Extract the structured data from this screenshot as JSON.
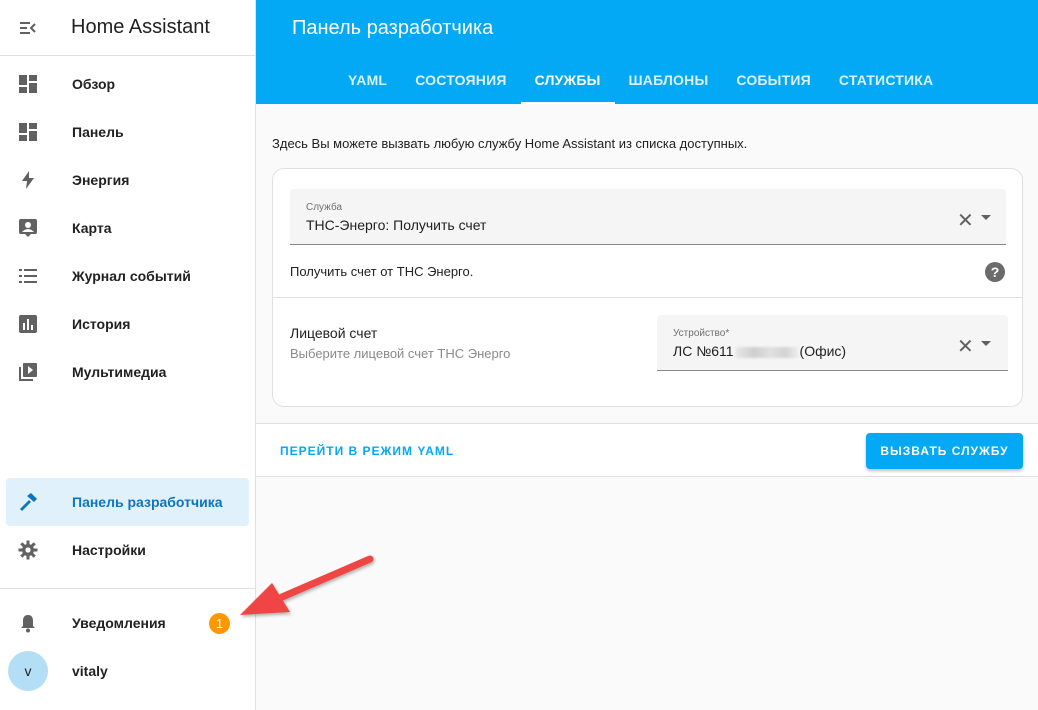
{
  "app": {
    "title": "Home Assistant"
  },
  "sidebar": {
    "items": [
      {
        "label": "Обзор",
        "icon": "overview-icon"
      },
      {
        "label": "Панель",
        "icon": "dashboard-icon"
      },
      {
        "label": "Энергия",
        "icon": "lightning-icon"
      },
      {
        "label": "Карта",
        "icon": "map-person-icon"
      },
      {
        "label": "Журнал событий",
        "icon": "list-icon"
      },
      {
        "label": "История",
        "icon": "chart-icon"
      },
      {
        "label": "Мультимедиа",
        "icon": "media-icon"
      }
    ],
    "bottom": [
      {
        "label": "Панель разработчика",
        "icon": "hammer-icon",
        "active": true
      },
      {
        "label": "Настройки",
        "icon": "gear-icon"
      }
    ],
    "notifications": {
      "label": "Уведомления",
      "count": "1"
    },
    "user": {
      "initial": "v",
      "name": "vitaly"
    }
  },
  "header": {
    "title": "Панель разработчика",
    "tabs": [
      "YAML",
      "СОСТОЯНИЯ",
      "СЛУЖБЫ",
      "ШАБЛОНЫ",
      "СОБЫТИЯ",
      "СТАТИСТИКА"
    ],
    "active_tab": "СЛУЖБЫ"
  },
  "services": {
    "intro": "Здесь Вы можете вызвать любую службу Home Assistant из списка доступных.",
    "service_field": {
      "label": "Служба",
      "value": "ТНС-Энерго: Получить счет"
    },
    "service_description": "Получить счет от ТНС Энерго.",
    "account": {
      "title": "Лицевой счет",
      "subtitle": "Выберите лицевой счет ТНС Энерго",
      "device_label": "Устройство*",
      "device_value_prefix": "ЛС №611",
      "device_value_suffix": "(Офис)"
    },
    "yaml_mode_label": "ПЕРЕЙТИ В РЕЖИМ YAML",
    "call_button_label": "ВЫЗВАТЬ СЛУЖБУ"
  },
  "colors": {
    "accent": "#03a9f4",
    "badge": "#ff9800",
    "annotation_arrow": "#ef4444"
  }
}
